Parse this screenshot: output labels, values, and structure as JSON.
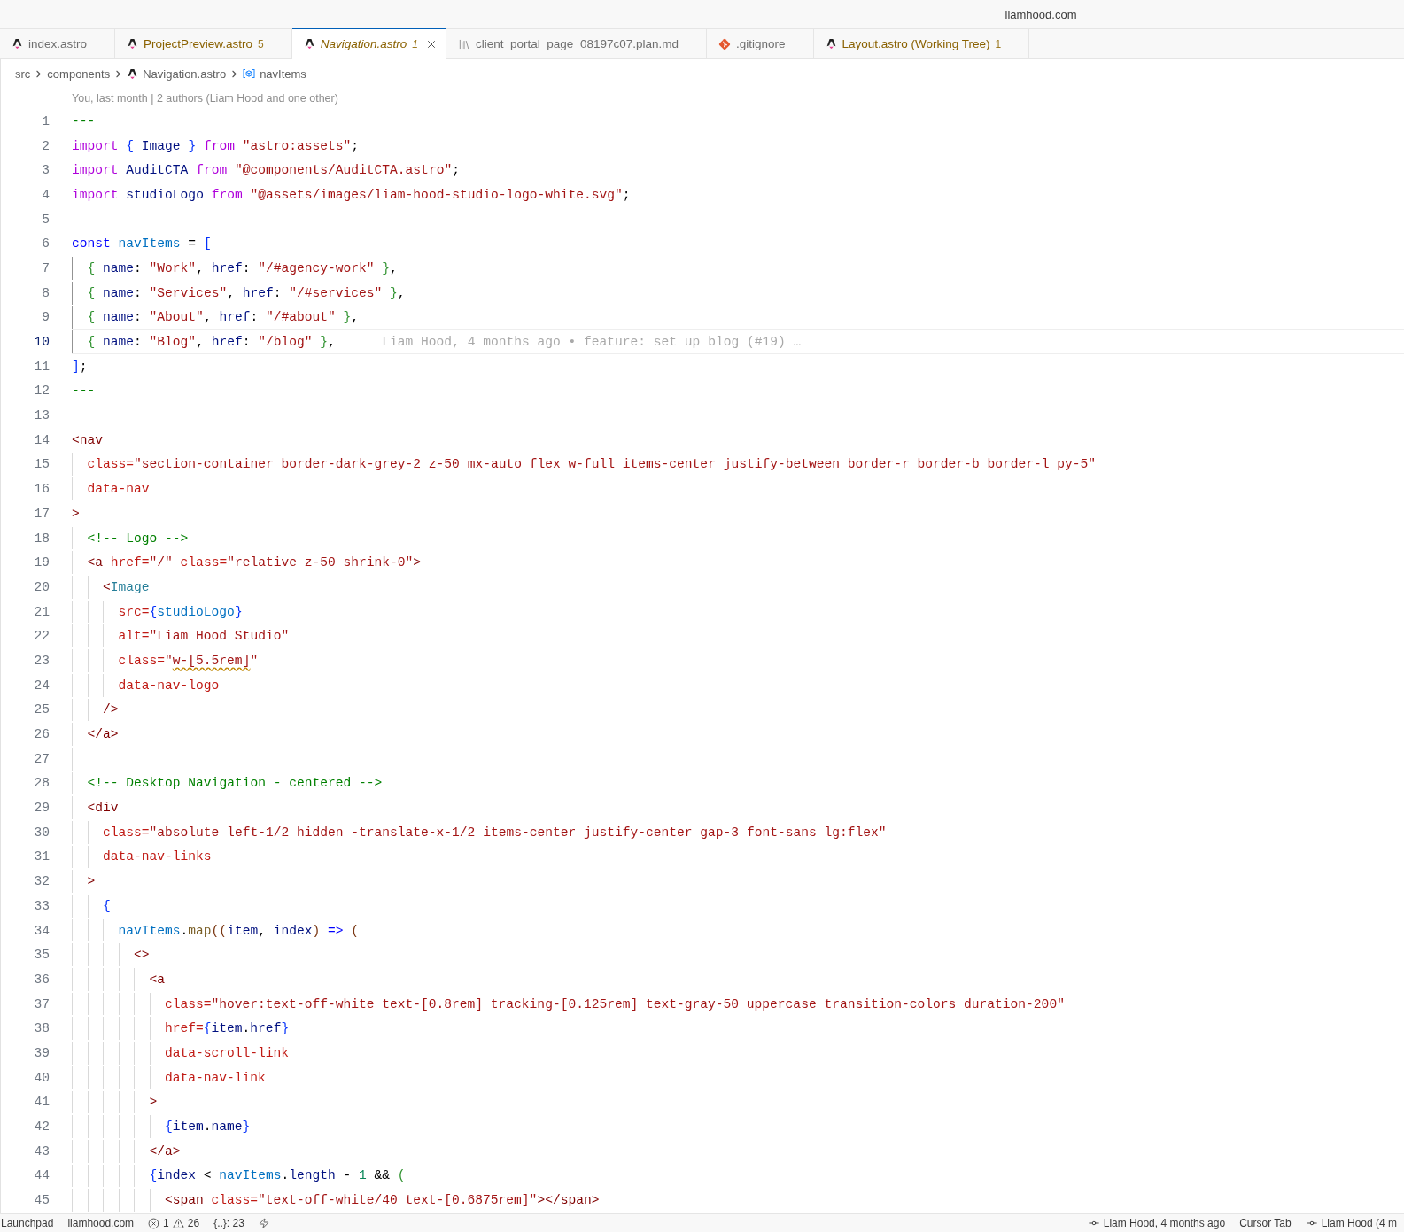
{
  "window": {
    "title": "liamhood.com"
  },
  "tabs": [
    {
      "label": "index.astro",
      "kind": "astro",
      "selected": false,
      "preview": false,
      "problems": false
    },
    {
      "label": "ProjectPreview.astro",
      "count": "5",
      "kind": "astro",
      "selected": false,
      "preview": false,
      "problems": true
    },
    {
      "label": "Navigation.astro",
      "count": "1",
      "kind": "astro",
      "selected": true,
      "preview": true,
      "problems": true
    },
    {
      "label": "client_portal_page_08197c07.plan.md",
      "kind": "doc",
      "selected": false,
      "preview": false,
      "problems": false
    },
    {
      "label": ".gitignore",
      "kind": "git",
      "selected": false,
      "preview": false,
      "problems": false
    },
    {
      "label": "Layout.astro (Working Tree)",
      "count": "1",
      "kind": "astro",
      "selected": false,
      "preview": false,
      "problems": true
    }
  ],
  "breadcrumbs": [
    {
      "label": "src",
      "kind": "folder"
    },
    {
      "label": "components",
      "kind": "folder"
    },
    {
      "label": "Navigation.astro",
      "kind": "astro"
    },
    {
      "label": "navItems",
      "kind": "variable"
    }
  ],
  "editor": {
    "codelens": "You, last month | 2 authors (Liam Hood and one other)",
    "lines": [
      {
        "number": "1",
        "current": false,
        "tokens": [
          {
            "text": "---",
            "kind": "fence"
          }
        ]
      },
      {
        "number": "2",
        "current": false,
        "tokens": [
          {
            "text": "import ",
            "kind": "keyword"
          },
          {
            "text": "{",
            "kind": "bracket1"
          },
          {
            "text": " Image ",
            "kind": "variable"
          },
          {
            "text": "}",
            "kind": "bracket1"
          },
          {
            "text": " from ",
            "kind": "keyword"
          },
          {
            "text": "\"astro:assets\"",
            "kind": "string"
          },
          {
            "text": ";",
            "kind": "plain"
          }
        ]
      },
      {
        "number": "3",
        "current": false,
        "tokens": [
          {
            "text": "import ",
            "kind": "keyword"
          },
          {
            "text": "AuditCTA ",
            "kind": "variable"
          },
          {
            "text": "from ",
            "kind": "keyword"
          },
          {
            "text": "\"@components/AuditCTA.astro\"",
            "kind": "string"
          },
          {
            "text": ";",
            "kind": "plain"
          }
        ]
      },
      {
        "number": "4",
        "current": false,
        "tokens": [
          {
            "text": "import ",
            "kind": "keyword"
          },
          {
            "text": "studioLogo ",
            "kind": "variable"
          },
          {
            "text": "from ",
            "kind": "keyword"
          },
          {
            "text": "\"@assets/images/liam-hood-studio-logo-white.svg\"",
            "kind": "string"
          },
          {
            "text": ";",
            "kind": "plain"
          }
        ]
      },
      {
        "number": "5",
        "current": false
      },
      {
        "number": "6",
        "current": false,
        "tokens": [
          {
            "text": "const ",
            "kind": "storage"
          },
          {
            "text": "navItems",
            "kind": "constant"
          },
          {
            "text": " = ",
            "kind": "plain"
          },
          {
            "text": "[",
            "kind": "bracket1"
          }
        ]
      },
      {
        "number": "7",
        "current": false,
        "tokens": [
          {
            "text": "  {",
            "kind": "bracket2"
          },
          {
            "text": " name",
            "kind": "variable"
          },
          {
            "text": ": ",
            "kind": "plain"
          },
          {
            "text": "\"Work\"",
            "kind": "string"
          },
          {
            "text": ", ",
            "kind": "plain"
          },
          {
            "text": "href",
            "kind": "variable"
          },
          {
            "text": ": ",
            "kind": "plain"
          },
          {
            "text": "\"/#agency-work\"",
            "kind": "string"
          },
          {
            "text": " }",
            "kind": "bracket2"
          },
          {
            "text": ",",
            "kind": "plain"
          }
        ]
      },
      {
        "number": "8",
        "current": false,
        "tokens": [
          {
            "text": "  {",
            "kind": "bracket2"
          },
          {
            "text": " name",
            "kind": "variable"
          },
          {
            "text": ": ",
            "kind": "plain"
          },
          {
            "text": "\"Services\"",
            "kind": "string"
          },
          {
            "text": ", ",
            "kind": "plain"
          },
          {
            "text": "href",
            "kind": "variable"
          },
          {
            "text": ": ",
            "kind": "plain"
          },
          {
            "text": "\"/#services\"",
            "kind": "string"
          },
          {
            "text": " }",
            "kind": "bracket2"
          },
          {
            "text": ",",
            "kind": "plain"
          }
        ]
      },
      {
        "number": "9",
        "current": false,
        "tokens": [
          {
            "text": "  {",
            "kind": "bracket2"
          },
          {
            "text": " name",
            "kind": "variable"
          },
          {
            "text": ": ",
            "kind": "plain"
          },
          {
            "text": "\"About\"",
            "kind": "string"
          },
          {
            "text": ", ",
            "kind": "plain"
          },
          {
            "text": "href",
            "kind": "variable"
          },
          {
            "text": ": ",
            "kind": "plain"
          },
          {
            "text": "\"/#about\"",
            "kind": "string"
          },
          {
            "text": " }",
            "kind": "bracket2"
          },
          {
            "text": ",",
            "kind": "plain"
          }
        ]
      },
      {
        "number": "10",
        "current": true,
        "tokens": [
          {
            "text": "  {",
            "kind": "bracket2"
          },
          {
            "text": " name",
            "kind": "variable"
          },
          {
            "text": ": ",
            "kind": "plain"
          },
          {
            "text": "\"Blog\"",
            "kind": "string"
          },
          {
            "text": ", ",
            "kind": "plain"
          },
          {
            "text": "href",
            "kind": "variable"
          },
          {
            "text": ": ",
            "kind": "plain"
          },
          {
            "text": "\"/blog\"",
            "kind": "string"
          },
          {
            "text": " }",
            "kind": "bracket2"
          },
          {
            "text": ",",
            "kind": "plain"
          }
        ],
        "blame": "Liam Hood, 4 months ago • feature: set up blog (#19) …"
      },
      {
        "number": "11",
        "current": false,
        "tokens": [
          {
            "text": "]",
            "kind": "bracket1"
          },
          {
            "text": ";",
            "kind": "plain"
          }
        ]
      },
      {
        "number": "12",
        "current": false,
        "tokens": [
          {
            "text": "---",
            "kind": "fence"
          }
        ]
      },
      {
        "number": "13",
        "current": false
      },
      {
        "number": "14",
        "current": false,
        "tokens": [
          {
            "text": "<nav",
            "kind": "tag"
          }
        ]
      },
      {
        "number": "15",
        "current": false,
        "tokens": [
          {
            "text": "  class=",
            "kind": "attr"
          },
          {
            "text": "\"section-container border-dark-grey-2 z-50 mx-auto flex w-full items-center justify-between border-r border-b border-l py-5\"",
            "kind": "string"
          }
        ]
      },
      {
        "number": "16",
        "current": false,
        "tokens": [
          {
            "text": "  data-nav",
            "kind": "attr"
          }
        ]
      },
      {
        "number": "17",
        "current": false,
        "tokens": [
          {
            "text": ">",
            "kind": "tag"
          }
        ]
      },
      {
        "number": "18",
        "current": false,
        "tokens": [
          {
            "text": "  <!-- Logo -->",
            "kind": "comment"
          }
        ]
      },
      {
        "number": "19",
        "current": false,
        "tokens": [
          {
            "text": "  <a ",
            "kind": "tag"
          },
          {
            "text": "href=",
            "kind": "attr"
          },
          {
            "text": "\"/\" ",
            "kind": "string"
          },
          {
            "text": "class=",
            "kind": "attr"
          },
          {
            "text": "\"relative z-50 shrink-0\"",
            "kind": "string"
          },
          {
            "text": ">",
            "kind": "tag"
          }
        ]
      },
      {
        "number": "20",
        "current": false,
        "tokens": [
          {
            "text": "    <",
            "kind": "tag"
          },
          {
            "text": "Image",
            "kind": "component"
          }
        ]
      },
      {
        "number": "21",
        "current": false,
        "tokens": [
          {
            "text": "      src=",
            "kind": "attr"
          },
          {
            "text": "{",
            "kind": "bracket1"
          },
          {
            "text": "studioLogo",
            "kind": "constant"
          },
          {
            "text": "}",
            "kind": "bracket1"
          }
        ]
      },
      {
        "number": "22",
        "current": false,
        "tokens": [
          {
            "text": "      alt=",
            "kind": "attr"
          },
          {
            "text": "\"Liam Hood Studio\"",
            "kind": "string"
          }
        ]
      },
      {
        "number": "23",
        "current": false,
        "tokens": [
          {
            "text": "      class=",
            "kind": "attr"
          },
          {
            "text": "\"",
            "kind": "string"
          },
          {
            "text": "w-[5.5rem]",
            "kind": "flagged"
          },
          {
            "text": "\"",
            "kind": "string"
          }
        ]
      },
      {
        "number": "24",
        "current": false,
        "tokens": [
          {
            "text": "      data-nav-logo",
            "kind": "attr"
          }
        ]
      },
      {
        "number": "25",
        "current": false,
        "tokens": [
          {
            "text": "    />",
            "kind": "tag"
          }
        ]
      },
      {
        "number": "26",
        "current": false,
        "tokens": [
          {
            "text": "  </a>",
            "kind": "tag"
          }
        ]
      },
      {
        "number": "27",
        "current": false
      },
      {
        "number": "28",
        "current": false,
        "tokens": [
          {
            "text": "  <!-- Desktop Navigation - centered -->",
            "kind": "comment"
          }
        ]
      },
      {
        "number": "29",
        "current": false,
        "tokens": [
          {
            "text": "  <div",
            "kind": "tag"
          }
        ]
      },
      {
        "number": "30",
        "current": false,
        "tokens": [
          {
            "text": "    class=",
            "kind": "attr"
          },
          {
            "text": "\"absolute left-1/2 hidden -translate-x-1/2 items-center justify-center gap-3 font-sans lg:flex\"",
            "kind": "string"
          }
        ]
      },
      {
        "number": "31",
        "current": false,
        "tokens": [
          {
            "text": "    data-nav-links",
            "kind": "attr"
          }
        ]
      },
      {
        "number": "32",
        "current": false,
        "tokens": [
          {
            "text": "  >",
            "kind": "tag"
          }
        ]
      },
      {
        "number": "33",
        "current": false,
        "tokens": [
          {
            "text": "    {",
            "kind": "bracket1"
          }
        ]
      },
      {
        "number": "34",
        "current": false,
        "tokens": [
          {
            "text": "      navItems",
            "kind": "constant"
          },
          {
            "text": ".",
            "kind": "plain"
          },
          {
            "text": "map",
            "kind": "function"
          },
          {
            "text": "((",
            "kind": "bracket3"
          },
          {
            "text": "item",
            "kind": "variable"
          },
          {
            "text": ", ",
            "kind": "plain"
          },
          {
            "text": "index",
            "kind": "variable"
          },
          {
            "text": ")",
            "kind": "bracket3"
          },
          {
            "text": " => ",
            "kind": "storage"
          },
          {
            "text": "(",
            "kind": "bracket3"
          }
        ]
      },
      {
        "number": "35",
        "current": false,
        "tokens": [
          {
            "text": "        <>",
            "kind": "tag"
          }
        ]
      },
      {
        "number": "36",
        "current": false,
        "tokens": [
          {
            "text": "          <a",
            "kind": "tag"
          }
        ]
      },
      {
        "number": "37",
        "current": false,
        "tokens": [
          {
            "text": "            class=",
            "kind": "attr"
          },
          {
            "text": "\"hover:text-off-white text-[0.8rem] tracking-[0.125rem] text-gray-50 uppercase transition-colors duration-200\"",
            "kind": "string"
          }
        ]
      },
      {
        "number": "38",
        "current": false,
        "tokens": [
          {
            "text": "            href=",
            "kind": "attr"
          },
          {
            "text": "{",
            "kind": "bracket1"
          },
          {
            "text": "item",
            "kind": "variable"
          },
          {
            "text": ".",
            "kind": "plain"
          },
          {
            "text": "href",
            "kind": "variable"
          },
          {
            "text": "}",
            "kind": "bracket1"
          }
        ]
      },
      {
        "number": "39",
        "current": false,
        "tokens": [
          {
            "text": "            data-scroll-link",
            "kind": "attr"
          }
        ]
      },
      {
        "number": "40",
        "current": false,
        "tokens": [
          {
            "text": "            data-nav-link",
            "kind": "attr"
          }
        ]
      },
      {
        "number": "41",
        "current": false,
        "tokens": [
          {
            "text": "          >",
            "kind": "tag"
          }
        ]
      },
      {
        "number": "42",
        "current": false,
        "tokens": [
          {
            "text": "            {",
            "kind": "bracket1"
          },
          {
            "text": "item",
            "kind": "variable"
          },
          {
            "text": ".",
            "kind": "plain"
          },
          {
            "text": "name",
            "kind": "variable"
          },
          {
            "text": "}",
            "kind": "bracket1"
          }
        ]
      },
      {
        "number": "43",
        "current": false,
        "tokens": [
          {
            "text": "          </a>",
            "kind": "tag"
          }
        ]
      },
      {
        "number": "44",
        "current": false,
        "tokens": [
          {
            "text": "          {",
            "kind": "bracket1"
          },
          {
            "text": "index",
            "kind": "variable"
          },
          {
            "text": " < ",
            "kind": "plain"
          },
          {
            "text": "navItems",
            "kind": "constant"
          },
          {
            "text": ".",
            "kind": "plain"
          },
          {
            "text": "length",
            "kind": "variable"
          },
          {
            "text": " - ",
            "kind": "plain"
          },
          {
            "text": "1",
            "kind": "number"
          },
          {
            "text": " && ",
            "kind": "plain"
          },
          {
            "text": "(",
            "kind": "bracket2"
          }
        ]
      },
      {
        "number": "45",
        "current": false,
        "tokens": [
          {
            "text": "            <span ",
            "kind": "tag"
          },
          {
            "text": "class=",
            "kind": "attr"
          },
          {
            "text": "\"text-off-white/40 text-[0.6875rem]\"",
            "kind": "string"
          },
          {
            "text": "></span>",
            "kind": "tag"
          }
        ]
      }
    ]
  },
  "status_bar": {
    "left": [
      {
        "kind": "text",
        "label": "Launchpad"
      },
      {
        "kind": "text",
        "label": "liamhood.com"
      },
      {
        "kind": "problems",
        "errors": "1",
        "warnings": "26"
      },
      {
        "kind": "text",
        "label": "{..}: 23"
      },
      {
        "kind": "indicator"
      }
    ],
    "right": [
      {
        "kind": "commit",
        "label": "Liam Hood, 4 months ago"
      },
      {
        "kind": "text",
        "label": "Cursor Tab"
      },
      {
        "kind": "commit",
        "label": "Liam Hood (4 m"
      }
    ]
  }
}
